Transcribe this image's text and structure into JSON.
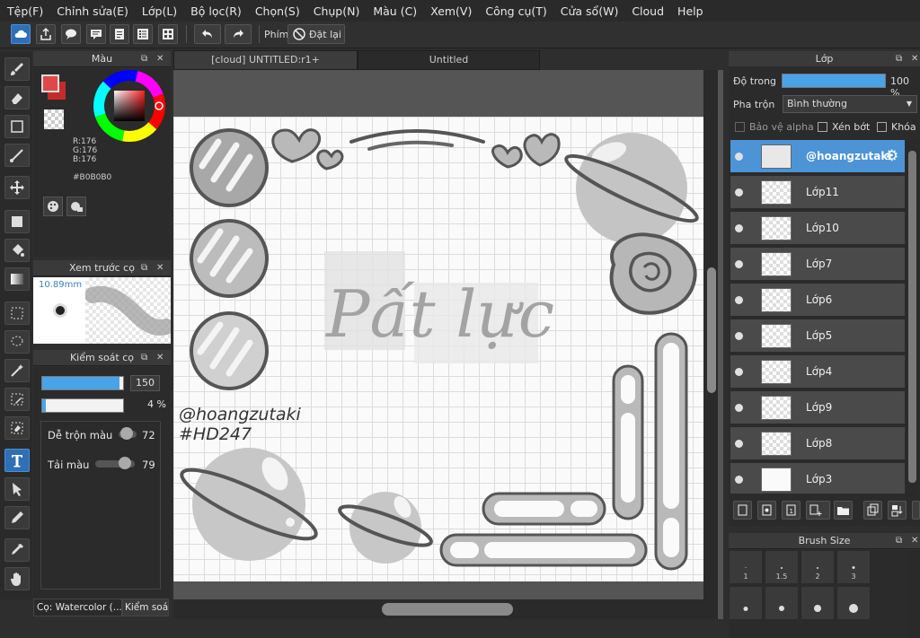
{
  "menu": [
    "Tệp(F)",
    "Chỉnh sửa(E)",
    "Lớp(L)",
    "Bộ lọc(R)",
    "Chọn(S)",
    "Chụp(N)",
    "Màu (C)",
    "Xem(V)",
    "Công cụ(T)",
    "Cửa sổ(W)",
    "Cloud",
    "Help"
  ],
  "toolbar": {
    "shortcut_label": "Phím",
    "reset_label": "Đặt lại"
  },
  "color_panel": {
    "title": "Màu",
    "r": "R:176",
    "g": "G:176",
    "b": "B:176",
    "hex": "#B0B0B0",
    "fg_color": "#e04848",
    "bg_color": "#c62b2b"
  },
  "brush_preview": {
    "title": "Xem trước cọ",
    "size": "10.89mm"
  },
  "brush_control": {
    "title": "Kiểm soát cọ",
    "size_value": "150",
    "size_fraction": 0.95,
    "opacity_value": "4 %",
    "opacity_fraction": 0.04,
    "blend_label": "Dễ trộn màu",
    "blend_value": "72",
    "load_label": "Tải màu",
    "load_value": "79",
    "bottom_tab1": "Cọ: Watercolor (...",
    "bottom_tab2": "Kiểm soá..."
  },
  "doc_tabs": [
    "[cloud] UNTITLED:r1+",
    "Untitled"
  ],
  "canvas_text": {
    "handle": "@hoangzutaki",
    "tag": "#HD247",
    "title": "Pất lực"
  },
  "layer_panel": {
    "title": "Lớp",
    "opacity_label": "Độ trong",
    "opacity_value": "100 %",
    "opacity_fraction": 1.0,
    "blend_label": "Pha trộn",
    "blend_mode": "Bình thường",
    "protect_alpha": "Bảo vệ alpha",
    "clipping": "Xén bớt",
    "lock": "Khóa",
    "layers": [
      {
        "name": "@hoangzutaki",
        "selected": true
      },
      {
        "name": "Lớp11",
        "selected": false
      },
      {
        "name": "Lớp10",
        "selected": false
      },
      {
        "name": "Lớp7",
        "selected": false
      },
      {
        "name": "Lớp6",
        "selected": false
      },
      {
        "name": "Lớp5",
        "selected": false
      },
      {
        "name": "Lớp4",
        "selected": false
      },
      {
        "name": "Lớp9",
        "selected": false
      },
      {
        "name": "Lớp8",
        "selected": false
      },
      {
        "name": "Lớp3",
        "selected": false
      }
    ]
  },
  "brush_size_panel": {
    "title": "Brush Size",
    "sizes": [
      "1",
      "1.5",
      "2",
      "3"
    ]
  },
  "accent_color": "#4aa3e6"
}
